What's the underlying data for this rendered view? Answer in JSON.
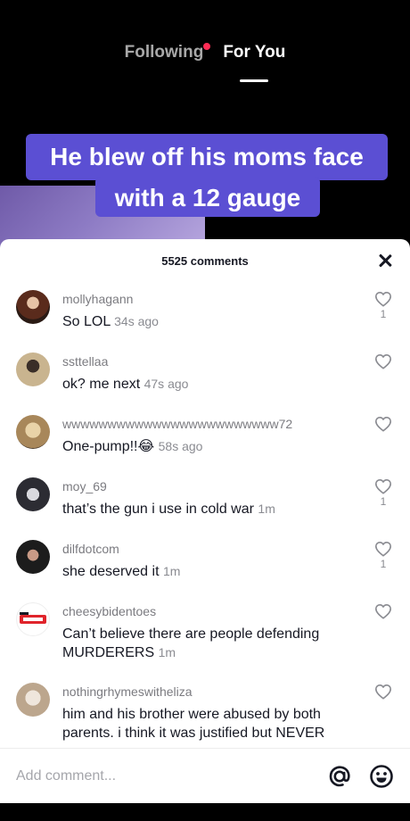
{
  "nav": {
    "following_label": "Following",
    "for_you_label": "For You"
  },
  "video": {
    "caption_line1": "He blew off his moms face",
    "caption_line2": "with a 12 gauge"
  },
  "comments_sheet": {
    "title": "5525 comments",
    "items": [
      {
        "username": "mollyhagann",
        "text": "So LOL",
        "time": "34s ago",
        "likes": "1",
        "avatar_color": "#6b3a2a"
      },
      {
        "username": "ssttellaa",
        "text": "ok? me next",
        "time": "47s ago",
        "likes": "",
        "avatar_color": "#a38a6a"
      },
      {
        "username": "wwwwwwwwwwwwwwwwwwwwwwww72",
        "text": "One-pump!!😂",
        "time": "58s ago",
        "likes": "",
        "avatar_color": "#c4a47a"
      },
      {
        "username": "moy_69",
        "text": "that’s the gun i use in cold war",
        "time": "1m",
        "likes": "1",
        "avatar_color": "#3a3a44"
      },
      {
        "username": "dilfdotcom",
        "text": "she deserved it",
        "time": "1m",
        "likes": "1",
        "avatar_color": "#2b2b2b"
      },
      {
        "username": "cheesybidentoes",
        "text": "Can’t believe there are people defending MURDERERS",
        "time": "1m",
        "likes": "",
        "avatar_color": "#ffffff"
      },
      {
        "username": "nothingrhymeswitheliza",
        "text": "him and his brother were abused by both parents. i think it was justified but NEVER",
        "time": "",
        "likes": "",
        "avatar_color": "#d8c8b4"
      }
    ],
    "input_placeholder": "Add comment..."
  },
  "colors": {
    "caption_bg": "#5b4fd3",
    "notification_dot": "#fe2c55"
  }
}
